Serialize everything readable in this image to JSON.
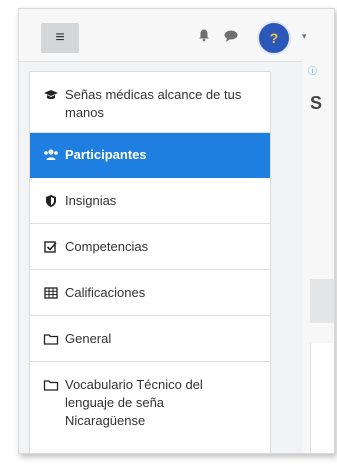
{
  "header": {
    "menu_icon": "≡",
    "bell_icon": "bell-icon",
    "chat_icon": "chat-icon",
    "avatar_glyph": "?",
    "caret": "▾",
    "info_icon": "ⓘ"
  },
  "page": {
    "heading_fragment": "S"
  },
  "drawer": {
    "items": [
      {
        "icon": "🎓",
        "label": "Señas médicas alcance de tus manos"
      },
      {
        "icon": "👥",
        "label": "Participantes"
      },
      {
        "icon": "🛡",
        "label": "Insignias"
      },
      {
        "icon": "☑",
        "label": "Competencias"
      },
      {
        "icon": "▦",
        "label": "Calificaciones"
      },
      {
        "icon": "▭",
        "label": "General"
      },
      {
        "icon": "▭",
        "label": "Vocabulario Técnico del lenguaje de seña Nicaragüense"
      }
    ]
  },
  "colors": {
    "accent": "#1f7fe0",
    "avatar": "#2a57b8"
  }
}
